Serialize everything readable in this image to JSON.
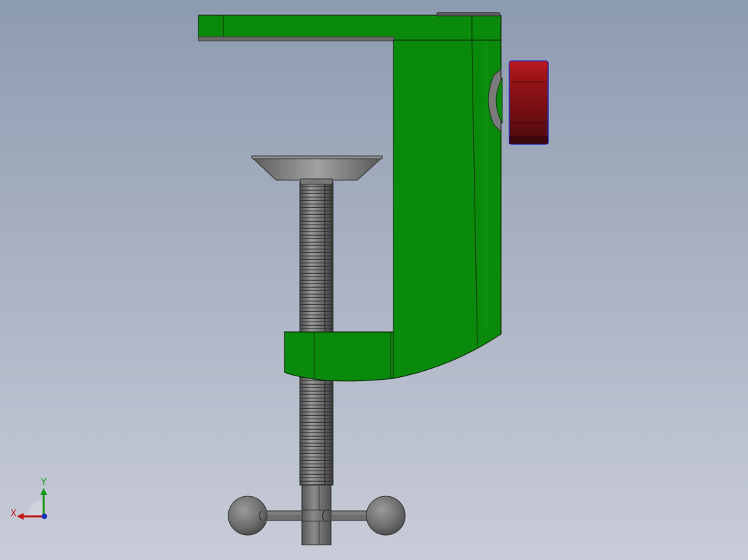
{
  "viewport": {
    "background_top": "#8d9bb0",
    "background_bottom": "#c6cad6"
  },
  "model": {
    "frame_color": "#0a8a0a",
    "frame_shade": "#087008",
    "knob_color": "#8a1216",
    "screw_color": "#707070",
    "handle_color": "#6d6d6d"
  },
  "triad": {
    "x_label": "X",
    "y_label": "Y",
    "x_color": "#c01818",
    "y_color": "#1a9a1a",
    "z_color": "#1c2fbf"
  }
}
